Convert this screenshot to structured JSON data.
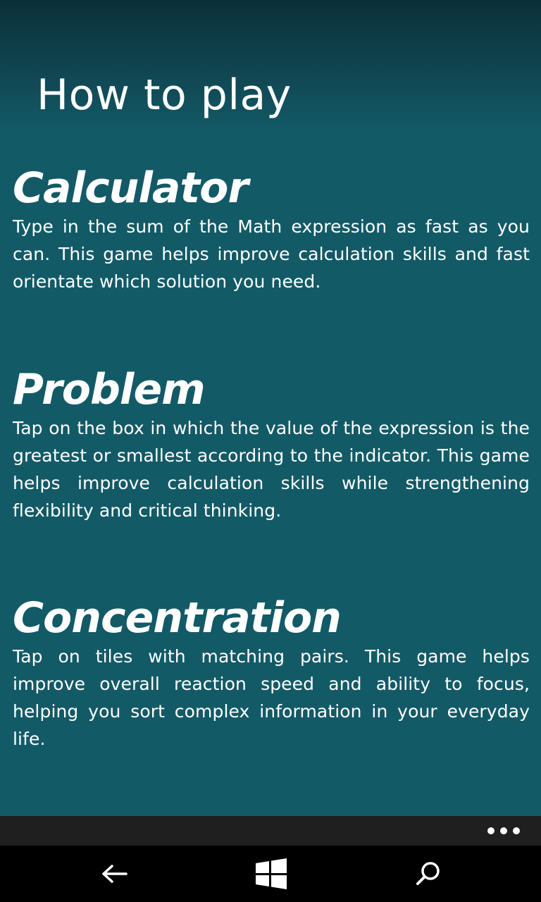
{
  "page": {
    "title": "How to play"
  },
  "sections": [
    {
      "heading": "Calculator",
      "body": "Type in the sum of the Math expression as fast as you can. This game helps improve calculation skills and fast orientate which solution you need."
    },
    {
      "heading": "Problem",
      "body": "Tap on the box in which the value of the expression is the greatest or smallest according to the indicator. This game helps improve calculation skills while strengthening flexibility and critical thinking."
    },
    {
      "heading": "Concentration",
      "body": "Tap on tiles with matching pairs. This game helps improve overall reaction speed and ability to focus, helping you sort complex information in your everyday life."
    }
  ],
  "appbar": {
    "more_icon": "ellipsis-icon"
  },
  "navbar": {
    "back_icon": "back-arrow-icon",
    "start_icon": "windows-logo-icon",
    "search_icon": "search-icon"
  },
  "colors": {
    "background": "#135a67",
    "header_dark": "#0c2f38",
    "appbar": "#1f1f1f",
    "navbar": "#000000",
    "text": "#ffffff"
  }
}
